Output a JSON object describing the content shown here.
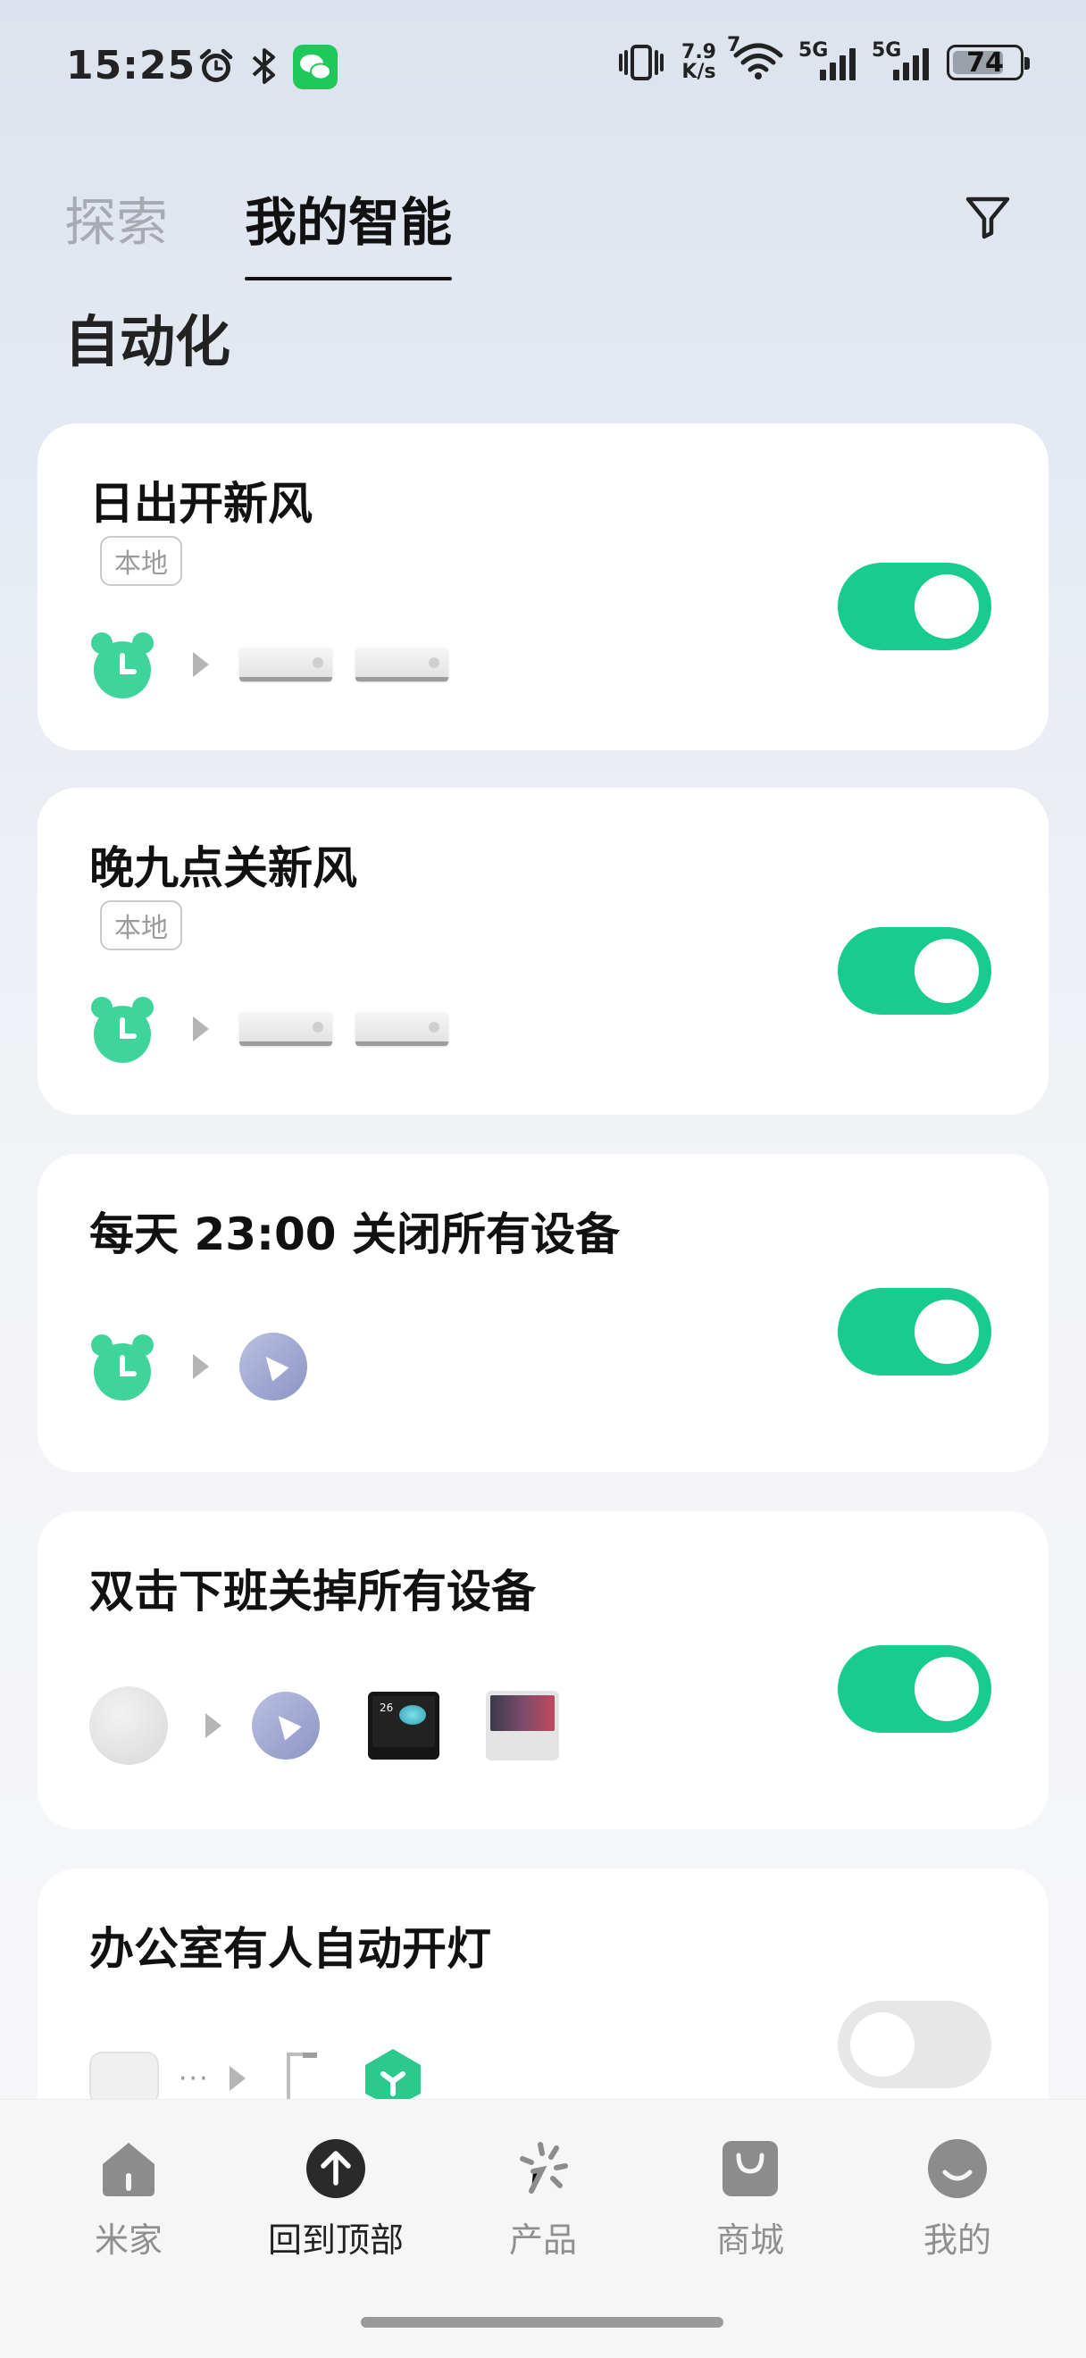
{
  "status_bar": {
    "time": "15:25",
    "net_speed_top": "7.9",
    "net_speed_bottom": "K/s",
    "wifi_badge": "7",
    "sig1_label": "5G",
    "sig2_label": "5G",
    "battery": "74"
  },
  "tabs": {
    "explore": "探索",
    "mine": "我的智能"
  },
  "section_title": "自动化",
  "cards": [
    {
      "title": "日出开新风",
      "badge": "本地",
      "enabled": true
    },
    {
      "title": "晚九点关新风",
      "badge": "本地",
      "enabled": true
    },
    {
      "title": "每天 23:00 关闭所有设备",
      "enabled": true
    },
    {
      "title": "双击下班关掉所有设备",
      "enabled": true
    },
    {
      "title": "办公室有人自动开灯",
      "enabled": false
    }
  ],
  "panel_dark_text": "26",
  "bottom_nav": {
    "home": "米家",
    "back_to_top": "回到顶部",
    "products": "产品",
    "mall": "商城",
    "mine": "我的"
  },
  "colors": {
    "accent_green": "#18cb8f",
    "alarm_green": "#3fd49a",
    "toggle_off": "#e7e7e7"
  }
}
